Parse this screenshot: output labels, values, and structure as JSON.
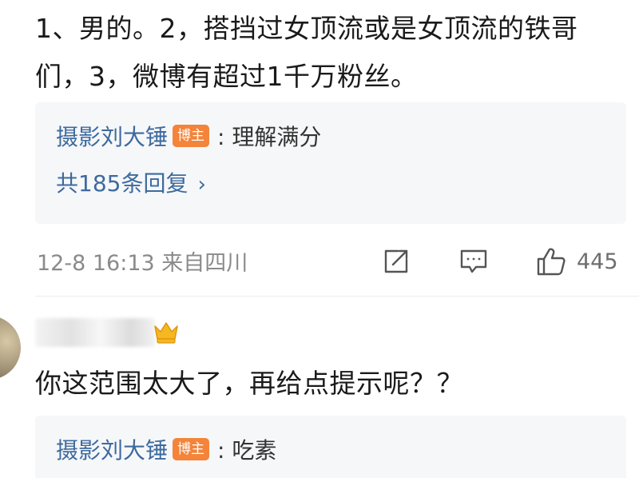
{
  "comment1": {
    "text": "1、男的。2，搭挡过女顶流或是女顶流的铁哥们，3，微博有超过1千万粉丝。",
    "reply": {
      "author": "摄影刘大锤",
      "badge": "博主",
      "colon": ":",
      "text": "理解满分"
    },
    "more_replies": "共185条回复",
    "meta": {
      "time": "12-8 16:13",
      "location": "来自四川"
    },
    "actions": {
      "like_count": "445",
      "share_icon": "share-icon",
      "comment_icon": "comment-icon",
      "like_icon": "thumbs-up-icon"
    }
  },
  "comment2": {
    "text": "你这范围太大了，再给点提示呢？？",
    "reply": {
      "author": "摄影刘大锤",
      "badge": "博主",
      "colon": ":",
      "text": "吃素"
    }
  },
  "colors": {
    "author_link": "#3d6a9e",
    "badge": "#f3843a",
    "reply_bg": "#f6f7f9",
    "meta_text": "#8a8a8a"
  }
}
